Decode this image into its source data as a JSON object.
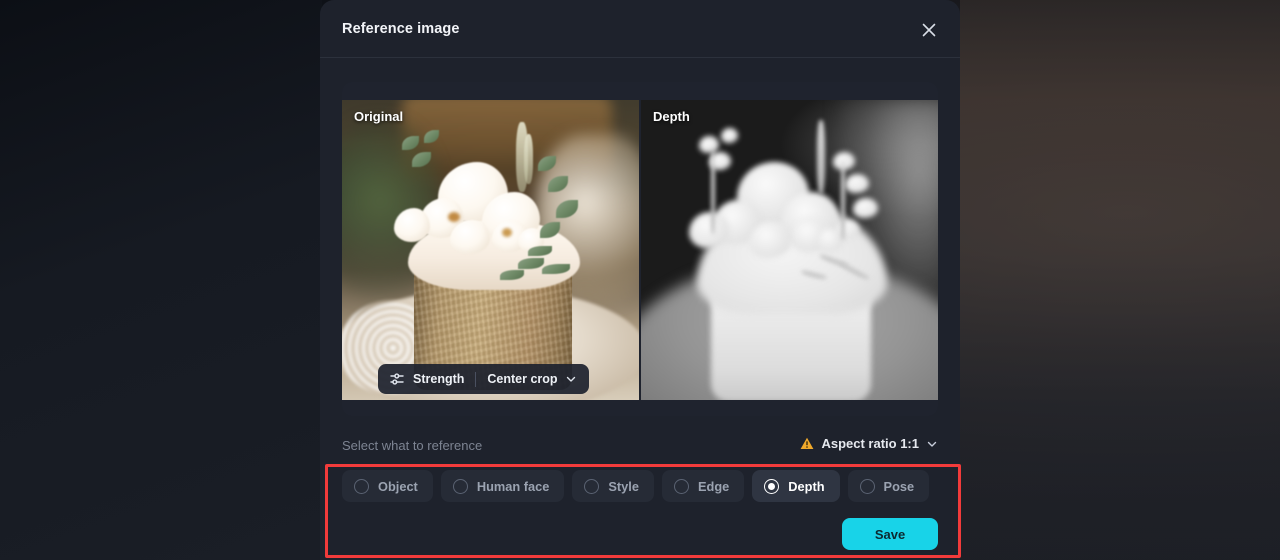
{
  "dialog": {
    "title": "Reference image",
    "close_icon": "close-x-icon"
  },
  "media": {
    "original": {
      "label": "Original",
      "alt": "Wedding cake with white orchids and eucalyptus on a lace plate"
    },
    "depth": {
      "label": "Depth",
      "alt": "Grayscale depth map of the wedding cake"
    },
    "toolbar": {
      "strength_icon": "sliders-icon",
      "strength_label": "Strength",
      "crop_label": "Center crop",
      "crop_chevron_icon": "chevron-down-icon"
    }
  },
  "subheader": {
    "prompt": "Select what to reference",
    "warning_icon": "warning-triangle-icon",
    "aspect_label": "Aspect ratio 1:1",
    "aspect_chevron_icon": "chevron-down-icon"
  },
  "options": [
    {
      "label": "Object",
      "selected": false
    },
    {
      "label": "Human face",
      "selected": false
    },
    {
      "label": "Style",
      "selected": false
    },
    {
      "label": "Edge",
      "selected": false
    },
    {
      "label": "Depth",
      "selected": true
    },
    {
      "label": "Pose",
      "selected": false
    }
  ],
  "actions": {
    "save_label": "Save"
  },
  "colors": {
    "accent": "#18d3e8",
    "warning": "#f0a92b",
    "annotation": "#f23b3b",
    "dialog_bg": "#1e222c",
    "chip_bg": "#262b36",
    "chip_selected_bg": "#2f3542"
  }
}
